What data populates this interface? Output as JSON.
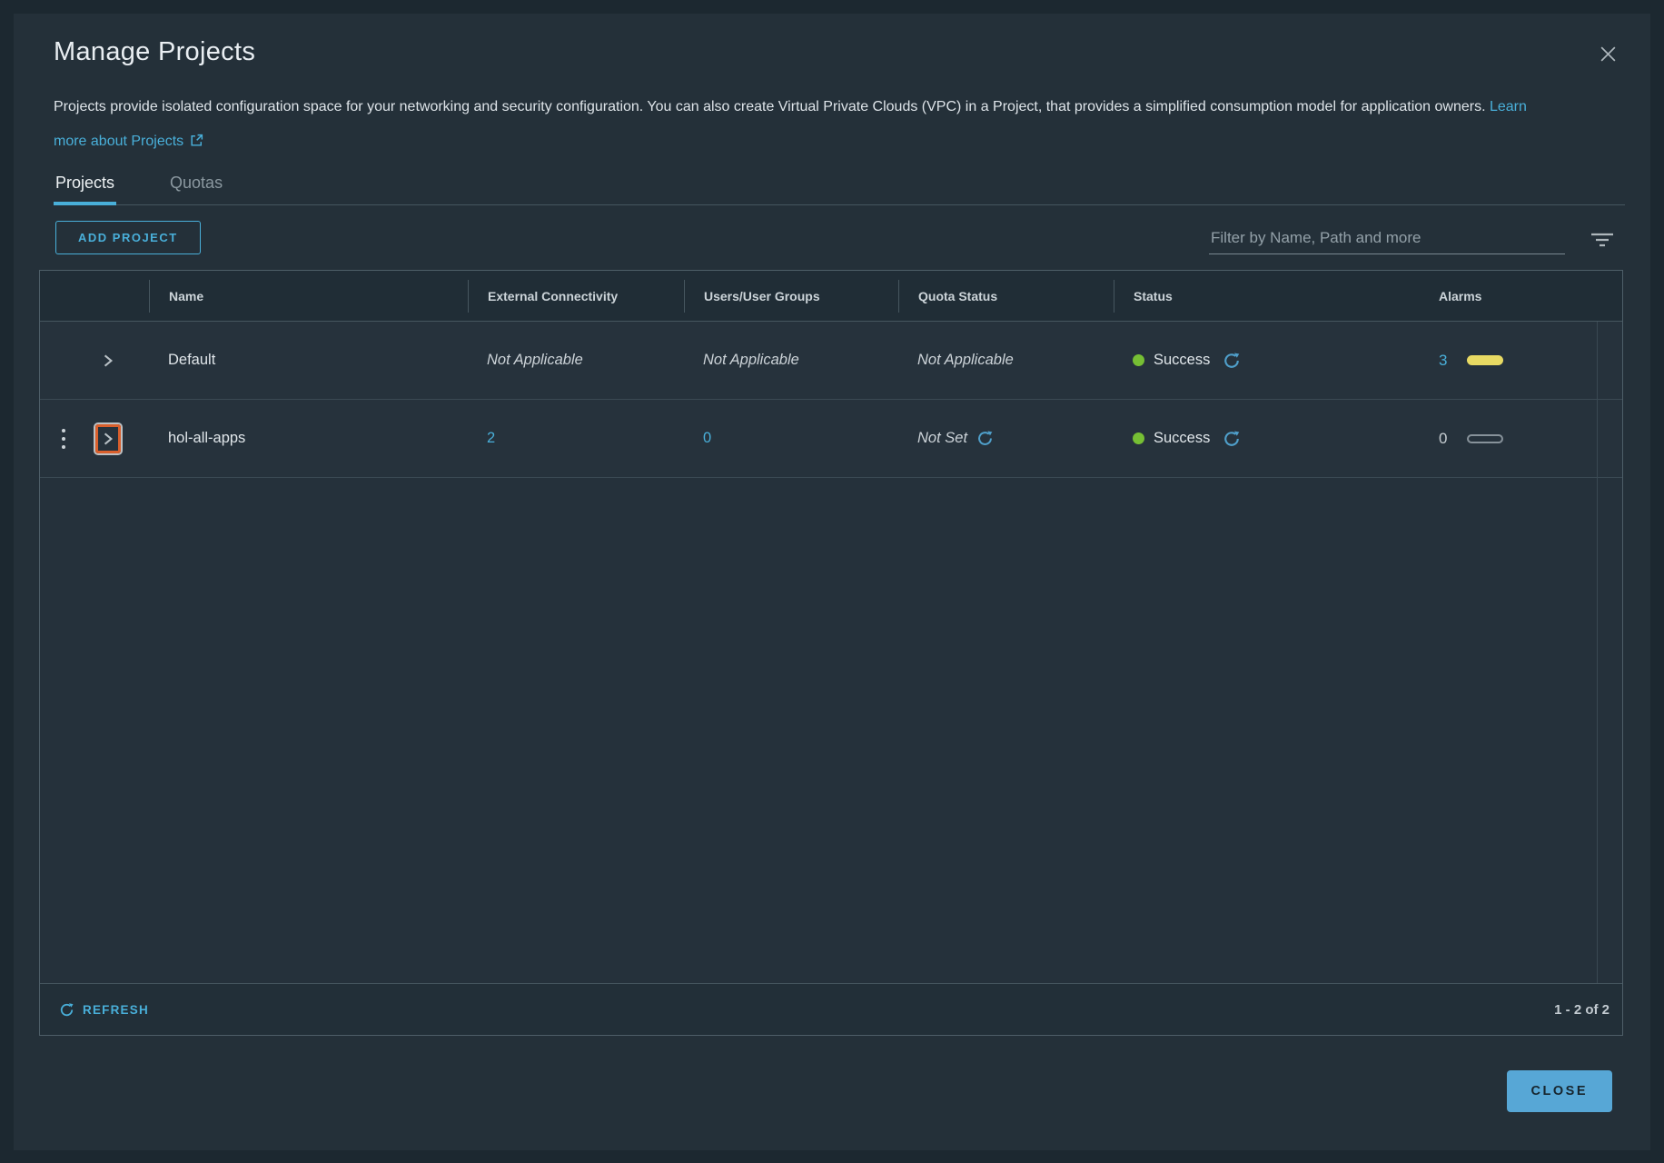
{
  "dialog": {
    "title": "Manage Projects",
    "description": "Projects provide isolated configuration space for your networking and security configuration. You can also create Virtual Private Clouds (VPC) in a Project, that provides a simplified consumption model for application owners.",
    "learn_more_label": "Learn more about Projects",
    "close_action_label": "CLOSE"
  },
  "tabs": [
    {
      "label": "Projects",
      "active": true
    },
    {
      "label": "Quotas",
      "active": false
    }
  ],
  "toolbar": {
    "add_project_label": "ADD PROJECT",
    "filter_placeholder": "Filter by Name, Path and more"
  },
  "table": {
    "columns": {
      "name": "Name",
      "external_connectivity": "External Connectivity",
      "users": "Users/User Groups",
      "quota_status": "Quota Status",
      "status": "Status",
      "alarms": "Alarms"
    },
    "rows": [
      {
        "name": "Default",
        "external_connectivity": "Not Applicable",
        "users": "Not Applicable",
        "quota_status": "Not Applicable",
        "status": "Success",
        "alarms": "3"
      },
      {
        "name": "hol-all-apps",
        "external_connectivity": "2",
        "users": "0",
        "quota_status": "Not Set",
        "status": "Success",
        "alarms": "0"
      }
    ],
    "footer": {
      "refresh_label": "REFRESH",
      "range": "1 - 2 of 2"
    }
  },
  "icons": {
    "close": "close-icon (thin x)",
    "external_link": "external-link-icon (box with arrow)",
    "filter": "filter-icon (three shrinking bars)",
    "expand": "chevron-right-icon",
    "kebab": "vertical-ellipsis-icon",
    "refresh": "refresh-icon (circular arrow)",
    "status_dot": "green-status-dot"
  },
  "colors": {
    "accent_blue": "#49afd9",
    "success_green": "#76bf34",
    "alarm_yellow": "#e8da63",
    "highlight_orange": "#d95f2c",
    "close_button_bg": "#57a7d6",
    "dialog_bg": "#243039",
    "page_bg": "#1c2830"
  }
}
